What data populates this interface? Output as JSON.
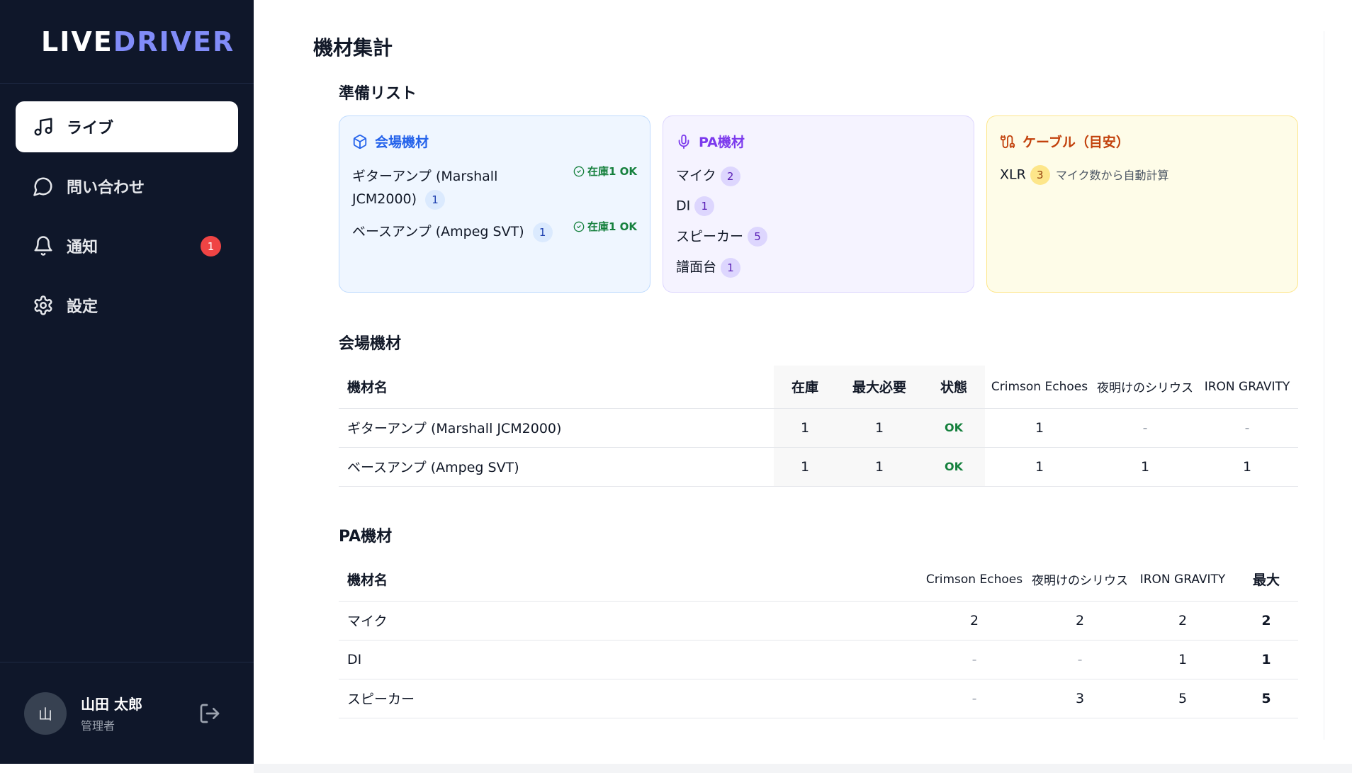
{
  "app": {
    "logo_a": "LIVE",
    "logo_b": "DRIVER"
  },
  "sidebar": {
    "items": [
      {
        "label": "ライブ",
        "icon": "music-icon",
        "active": true
      },
      {
        "label": "問い合わせ",
        "icon": "chat-icon"
      },
      {
        "label": "通知",
        "icon": "bell-icon",
        "badge": "1"
      },
      {
        "label": "設定",
        "icon": "gear-icon"
      }
    ],
    "user": {
      "initial": "山",
      "name": "山田 太郎",
      "role": "管理者"
    }
  },
  "page": {
    "title": "機材集計",
    "prep_title": "準備リスト",
    "venue_title": "会場機材",
    "pa_title": "PA機材"
  },
  "cards": {
    "venue": {
      "title": "会場機材",
      "items": [
        {
          "name": "ギターアンプ (Marshall JCM2000)",
          "qty": "1",
          "status": "在庫1 OK"
        },
        {
          "name": "ベースアンプ (Ampeg SVT)",
          "qty": "1",
          "status": "在庫1 OK"
        }
      ]
    },
    "pa": {
      "title": "PA機材",
      "items": [
        {
          "name": "マイク",
          "qty": "2"
        },
        {
          "name": "DI",
          "qty": "1"
        },
        {
          "name": "スピーカー",
          "qty": "5"
        },
        {
          "name": "譜面台",
          "qty": "1"
        }
      ]
    },
    "cable": {
      "title": "ケーブル（目安）",
      "item": "XLR",
      "qty": "3",
      "note": "マイク数から自動計算"
    }
  },
  "venue_table": {
    "headers": [
      "機材名",
      "在庫",
      "最大必要",
      "状態",
      "Crimson Echoes",
      "夜明けのシリウス",
      "IRON GRAVITY"
    ],
    "rows": [
      [
        "ギターアンプ (Marshall JCM2000)",
        "1",
        "1",
        "OK",
        "1",
        "-",
        "-"
      ],
      [
        "ベースアンプ (Ampeg SVT)",
        "1",
        "1",
        "OK",
        "1",
        "1",
        "1"
      ]
    ]
  },
  "pa_table": {
    "headers": [
      "機材名",
      "Crimson Echoes",
      "夜明けのシリウス",
      "IRON GRAVITY",
      "最大"
    ],
    "rows": [
      [
        "マイク",
        "2",
        "2",
        "2",
        "2"
      ],
      [
        "DI",
        "-",
        "-",
        "1",
        "1"
      ],
      [
        "スピーカー",
        "-",
        "3",
        "5",
        "5"
      ]
    ]
  },
  "colors": {
    "sidebar_bg": "#0f172a",
    "accent": "#818cf8",
    "ok": "#15803d",
    "badge": "#ef4444"
  }
}
